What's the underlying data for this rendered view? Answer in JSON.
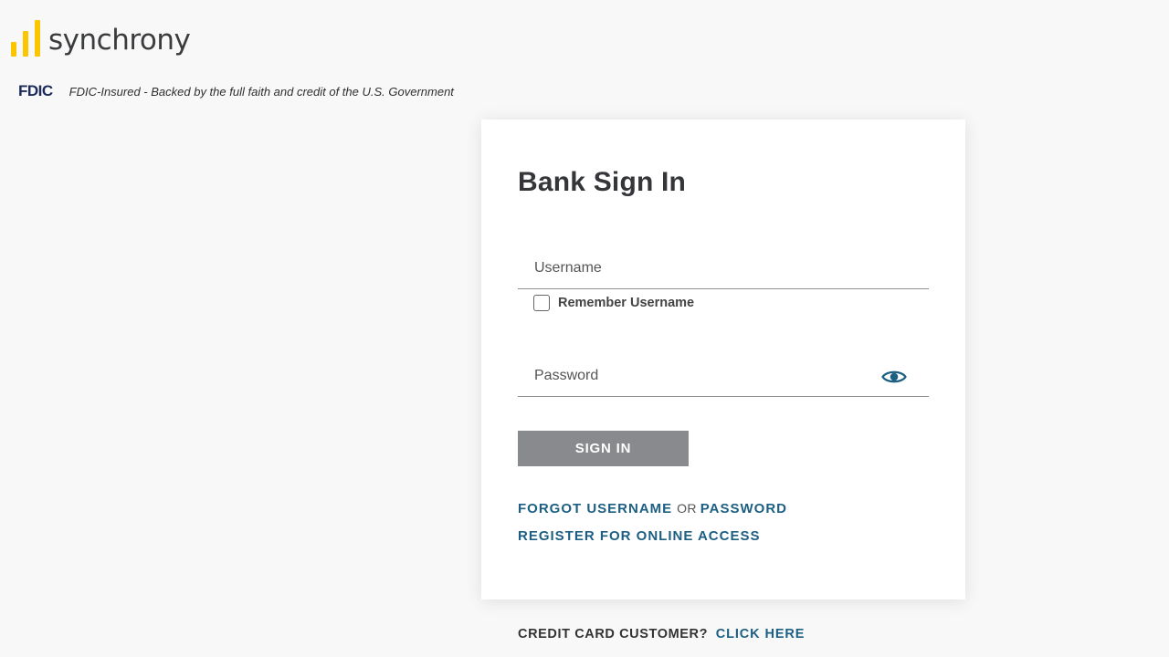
{
  "brand": {
    "name": "synchrony",
    "logo_color": "#fbc600",
    "fdic_logo": "FDIC",
    "fdic_text": "FDIC-Insured - Backed by the full faith and credit of the U.S. Government"
  },
  "signin": {
    "title": "Bank Sign In",
    "username_placeholder": "Username",
    "username_value": "",
    "remember_label": "Remember Username",
    "remember_checked": false,
    "password_placeholder": "Password",
    "password_value": "",
    "password_toggle_icon": "eye-icon",
    "submit_label": "SIGN IN",
    "forgot_username": "FORGOT USERNAME",
    "or_text": "OR",
    "forgot_password": "PASSWORD",
    "register": "REGISTER FOR ONLINE ACCESS"
  },
  "footer": {
    "credit_question": "CREDIT CARD CUSTOMER?",
    "click_here": "CLICK HERE"
  },
  "colors": {
    "link": "#1d5f82",
    "button": "#898a8d",
    "background": "#f8f8f9"
  }
}
